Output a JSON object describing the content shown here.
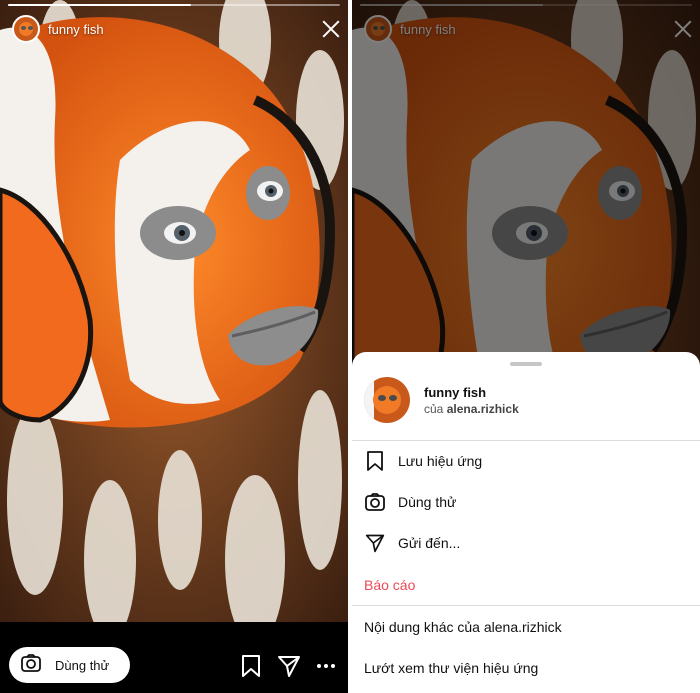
{
  "story": {
    "title": "funny fish",
    "progress": 0.55
  },
  "bottom_bar": {
    "try_label": "Dùng thử"
  },
  "sheet": {
    "effect_name": "funny fish",
    "by_prefix": "của",
    "creator": "alena.rizhick",
    "menu": [
      {
        "label": "Lưu hiệu ứng",
        "icon": "bookmark-icon"
      },
      {
        "label": "Dùng thử",
        "icon": "camera-icon"
      },
      {
        "label": "Gửi đến...",
        "icon": "send-icon"
      },
      {
        "label": "Báo cáo",
        "icon": ""
      },
      {
        "label": "Nội dung khác của alena.rizhick",
        "icon": ""
      },
      {
        "label": "Lướt xem thư viện hiệu ứng",
        "icon": ""
      }
    ]
  },
  "colors": {
    "danger": "#ed4956",
    "sheet_bg": "#ffffff",
    "backdrop": "#000000"
  }
}
